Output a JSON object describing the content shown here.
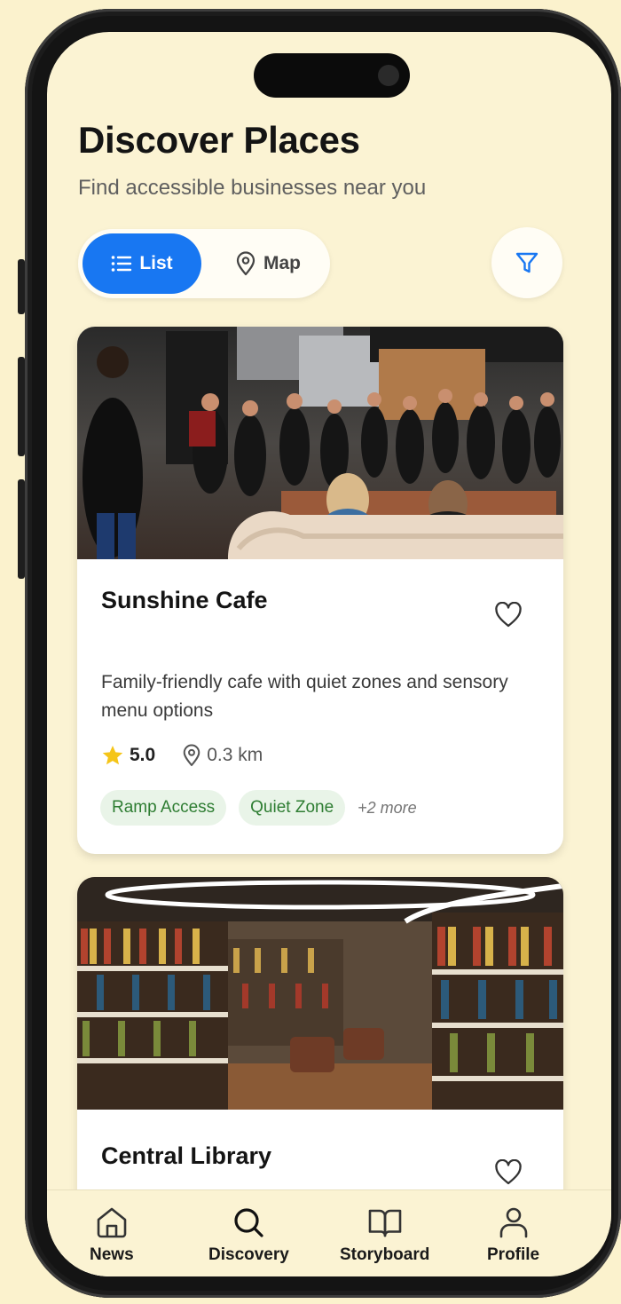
{
  "header": {
    "title": "Discover Places",
    "subtitle": "Find accessible businesses near you"
  },
  "view_toggle": {
    "list_label": "List",
    "map_label": "Map",
    "active": "List"
  },
  "filter": {
    "icon": "filter-icon"
  },
  "places": [
    {
      "name": "Sunshine Cafe",
      "description": "Family-friendly cafe with quiet zones and sensory menu options",
      "rating": "5.0",
      "distance": "0.3 km",
      "tags": [
        "Ramp Access",
        "Quiet Zone"
      ],
      "more_tags": "+2 more"
    },
    {
      "name": "Central Library"
    }
  ],
  "bottom_nav": {
    "items": [
      {
        "label": "News",
        "icon": "home-icon"
      },
      {
        "label": "Discovery",
        "icon": "search-icon"
      },
      {
        "label": "Storyboard",
        "icon": "book-icon"
      },
      {
        "label": "Profile",
        "icon": "user-icon"
      }
    ],
    "active": "Discovery"
  },
  "colors": {
    "background": "#fbf3d3",
    "accent": "#1877f2",
    "tag_bg": "#e9f4e8",
    "tag_text": "#2e7d32",
    "star": "#f5c518"
  }
}
